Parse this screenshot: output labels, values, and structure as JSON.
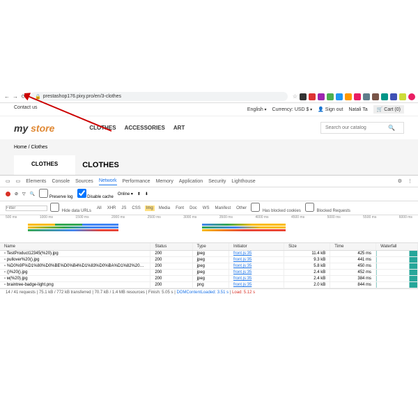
{
  "url": "prestashop176.pixy.pro/en/3-clothes",
  "topbar": {
    "contact": "Contact us",
    "language": "English",
    "currency_label": "Currency:",
    "currency": "USD $",
    "signout": "Sign out",
    "user": "Natali Ta",
    "cart": "Cart (0)"
  },
  "logo": {
    "a": "my",
    "b": "store"
  },
  "nav": [
    "CLOTHES",
    "ACCESSORIES",
    "ART"
  ],
  "search_ph": "Search our catalog",
  "crumb": "Home  /  Clothes",
  "tab": "CLOTHES",
  "heading": "CLOTHES",
  "devtools": {
    "tabs": [
      "Elements",
      "Console",
      "Sources",
      "Network",
      "Performance",
      "Memory",
      "Application",
      "Security",
      "Lighthouse"
    ],
    "toolbar": {
      "preserve": "Preserve log",
      "disable": "Disable cache",
      "online": "Online"
    },
    "filter_label": "Filter",
    "filters": [
      "Hide data URLs",
      "All",
      "XHR",
      "JS",
      "CSS",
      "Img",
      "Media",
      "Font",
      "Doc",
      "WS",
      "Manifest",
      "Other"
    ],
    "filter2": [
      "Has blocked cookies",
      "Blocked Requests"
    ],
    "time_marks": [
      "500 ms",
      "1000 ms",
      "1500 ms",
      "2000 ms",
      "2500 ms",
      "3000 ms",
      "3500 ms",
      "4000 ms",
      "4500 ms",
      "5000 ms",
      "5500 ms",
      "6000 ms"
    ],
    "columns": [
      "Name",
      "Status",
      "Type",
      "Initiator",
      "Size",
      "Time",
      "Waterfall"
    ],
    "rows": [
      {
        "name": "TestProduct12345(%20).jpg",
        "status": "200",
        "type": "jpeg",
        "init": "front.js:35",
        "size": "11.4 kB",
        "time": "425 ms"
      },
      {
        "name": "pullover%20().jpg",
        "status": "200",
        "type": "jpeg",
        "init": "front.js:35",
        "size": "9.3 kB",
        "time": "441 ms"
      },
      {
        "name": "%D0%9F%D1%80%D0%BE%D0%B4%D1%83%D0%BA%D1%82%20%D0%BA%D1%82%20...A%...",
        "status": "200",
        "type": "jpeg",
        "init": "front.js:35",
        "size": "5.8 kB",
        "time": "450 ms"
      },
      {
        "name": "()%20().jpg",
        "status": "200",
        "type": "jpeg",
        "init": "front.js:35",
        "size": "2.4 kB",
        "time": "452 ms"
      },
      {
        "name": "м(%20).jpg",
        "status": "200",
        "type": "jpeg",
        "init": "front.js:35",
        "size": "2.4 kB",
        "time": "384 ms"
      },
      {
        "name": "braintree-badge-light.png",
        "status": "200",
        "type": "png",
        "init": "front.js:35",
        "size": "2.0 kB",
        "time": "844 ms"
      }
    ],
    "summary": {
      "reqs": "14 / 41 requests",
      "transfer": "75.1 kB / 772 kB transferred",
      "resources": "70.7 kB / 1.4 MB resources",
      "finish": "Finish: 5.05 s",
      "dcl": "DOMContentLoaded: 3.51 s",
      "load": "Load: 5.12 s"
    }
  }
}
